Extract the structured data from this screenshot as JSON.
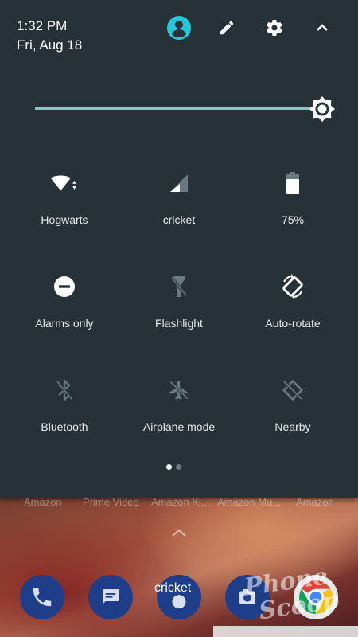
{
  "status": {
    "time": "1:32 PM",
    "date": "Fri, Aug 18"
  },
  "header_icons": [
    "user-account-icon",
    "edit-pencil-icon",
    "settings-gear-icon",
    "collapse-chevron-icon"
  ],
  "colors": {
    "shade": "#263238",
    "accent": "#80cbc4",
    "user_icon": "#26c6da",
    "disabled_icon": "#6b7a80"
  },
  "brightness": {
    "level": 0.93
  },
  "tiles": [
    {
      "label": "Hogwarts",
      "icon": "wifi-icon"
    },
    {
      "label": "cricket",
      "icon": "cellular-signal-icon"
    },
    {
      "label": "75%",
      "icon": "battery-icon"
    },
    {
      "label": "Alarms only",
      "icon": "do-not-disturb-icon"
    },
    {
      "label": "Flashlight",
      "icon": "flashlight-icon"
    },
    {
      "label": "Auto-rotate",
      "icon": "auto-rotate-icon"
    },
    {
      "label": "Bluetooth",
      "icon": "bluetooth-icon"
    },
    {
      "label": "Airplane mode",
      "icon": "airplane-icon"
    },
    {
      "label": "Nearby",
      "icon": "nearby-icon"
    }
  ],
  "page_indicator": {
    "current": 1,
    "total": 2
  },
  "home": {
    "app_labels": [
      "Amazon",
      "Prime Video",
      "Amazon Ki...",
      "Amazon Mu...",
      "Amazon"
    ],
    "dock_label": "cricket",
    "watermark": "Phone Scoop"
  }
}
